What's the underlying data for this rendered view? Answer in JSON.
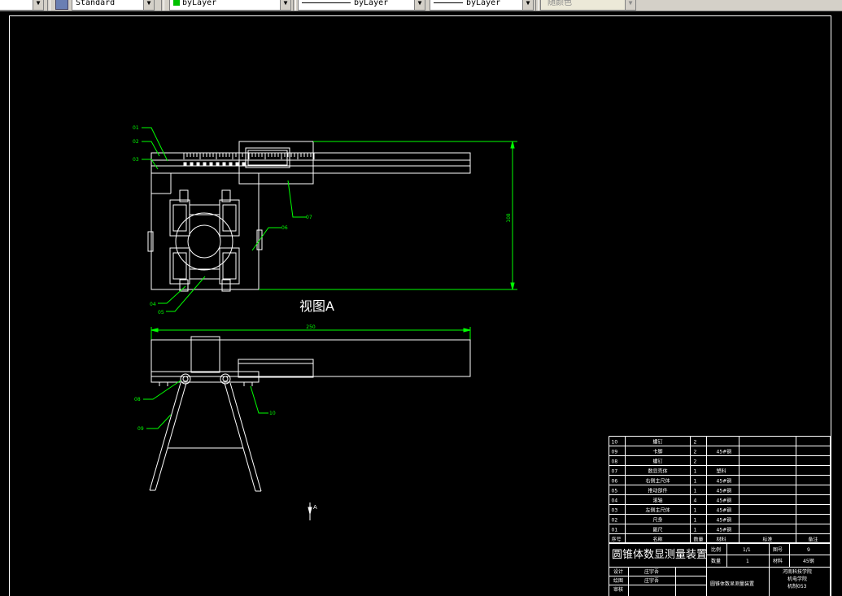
{
  "toolbar": {
    "text_style": "Standard",
    "color": "byLayer",
    "color_swatch": "#00c000",
    "linetype": "byLayer",
    "lineweight": "byLayer",
    "plotstyle": "随颜色"
  },
  "drawing": {
    "view_label": "视图A",
    "dim_width": "250",
    "dim_height": "108",
    "axis_label": "A",
    "callouts": [
      "01",
      "02",
      "03",
      "04",
      "05",
      "06",
      "07",
      "08",
      "09",
      "10"
    ]
  },
  "bom": {
    "rows": [
      {
        "no": "10",
        "name": "螺钉",
        "qty": "2",
        "material": "",
        "standard": "",
        "remark": ""
      },
      {
        "no": "09",
        "name": "卡脚",
        "qty": "2",
        "material": "45#钢",
        "standard": "",
        "remark": ""
      },
      {
        "no": "08",
        "name": "螺钉",
        "qty": "2",
        "material": "",
        "standard": "",
        "remark": ""
      },
      {
        "no": "07",
        "name": "数显壳体",
        "qty": "1",
        "material": "塑料",
        "standard": "",
        "remark": ""
      },
      {
        "no": "06",
        "name": "右侧主尺体",
        "qty": "1",
        "material": "45#钢",
        "standard": "",
        "remark": ""
      },
      {
        "no": "05",
        "name": "推动部件",
        "qty": "1",
        "material": "45#钢",
        "standard": "",
        "remark": ""
      },
      {
        "no": "04",
        "name": "滚轴",
        "qty": "4",
        "material": "45#钢",
        "standard": "",
        "remark": ""
      },
      {
        "no": "03",
        "name": "左侧主尺体",
        "qty": "1",
        "material": "45#钢",
        "standard": "",
        "remark": ""
      },
      {
        "no": "02",
        "name": "尺身",
        "qty": "1",
        "material": "45#钢",
        "standard": "",
        "remark": ""
      },
      {
        "no": "01",
        "name": "副尺",
        "qty": "1",
        "material": "45#钢",
        "standard": "",
        "remark": ""
      }
    ],
    "header": {
      "no": "序号",
      "name": "名称",
      "qty": "数量",
      "material": "材料",
      "standard": "标准",
      "remark": "备注"
    }
  },
  "title_block": {
    "title": "圆锥体数显测量装置",
    "scale_label": "比例",
    "scale_value": "1/1",
    "sheet_label": "图号",
    "sheet_value": "9",
    "qty_label": "数量",
    "qty_value": "1",
    "material_label": "材料",
    "material_value": "45钢",
    "design_label": "设计",
    "design_name": "庄宇吾",
    "draw_label": "绘图",
    "draw_name": "庄宇吾",
    "review_label": "审核",
    "drawing_name": "圆锥体数显测量装置",
    "school_line1": "河南科技学院",
    "school_line2": "机电学院",
    "school_line3": "机制053"
  },
  "colors": {
    "geometry": "#ffffff",
    "dimension": "#00ff00",
    "background": "#000000"
  }
}
